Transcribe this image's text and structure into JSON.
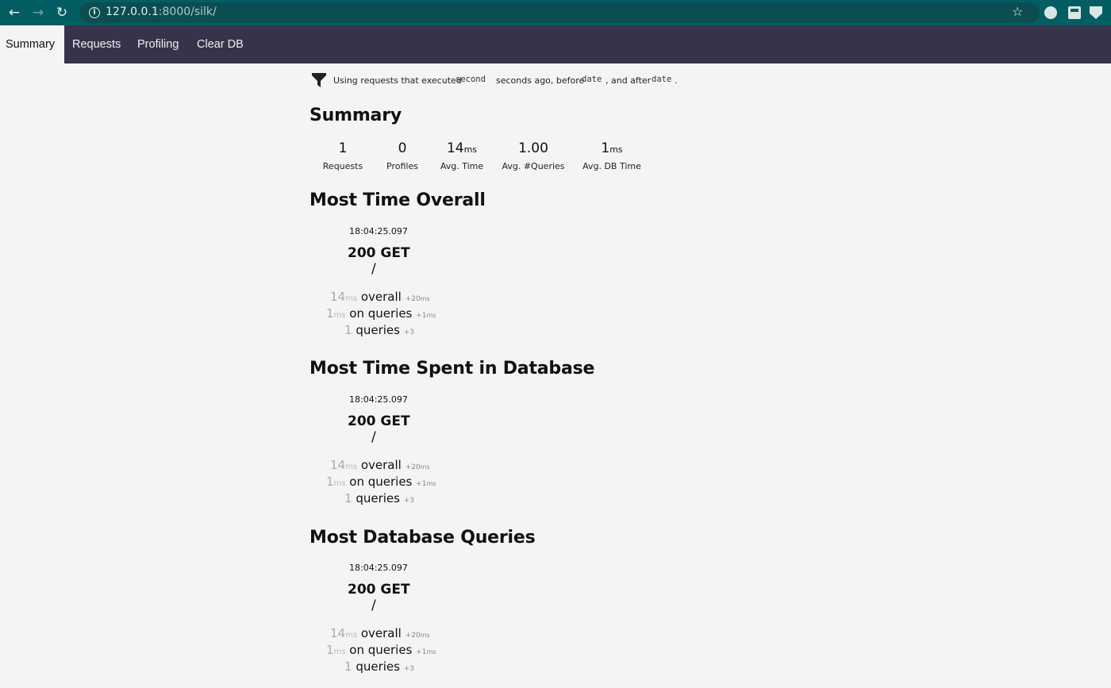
{
  "browser": {
    "url_host": "127.0.0.1",
    "url_rest": ":8000/silk/"
  },
  "nav": {
    "tabs": [
      {
        "label": "Summary"
      },
      {
        "label": "Requests"
      },
      {
        "label": "Profiling"
      },
      {
        "label": "Clear DB"
      }
    ]
  },
  "filter": {
    "prefix": "Using requests that executed",
    "code1": "second",
    "middle": "seconds ago, before",
    "code2": "date",
    "middle2": ", and after",
    "code3": "date",
    "suffix": "."
  },
  "summary": {
    "title": "Summary",
    "stats": [
      {
        "value": "1",
        "unit": "",
        "label": "Requests"
      },
      {
        "value": "0",
        "unit": "",
        "label": "Profiles"
      },
      {
        "value": "14",
        "unit": "ms",
        "label": "Avg. Time"
      },
      {
        "value": "1.00",
        "unit": "",
        "label": "Avg. #Queries"
      },
      {
        "value": "1",
        "unit": "ms",
        "label": "Avg. DB Time"
      }
    ]
  },
  "sections": [
    {
      "title": "Most Time Overall",
      "request": {
        "time": "18:04:25.097",
        "method": "200 GET",
        "path": "/",
        "overall_value": "14",
        "overall_unit": "ms",
        "overall_label": "overall",
        "overall_delta": "+20",
        "overall_delta_unit": "ms",
        "queries_time_value": "1",
        "queries_time_unit": "ms",
        "queries_time_label": "on queries",
        "queries_time_delta": "+1",
        "queries_time_delta_unit": "ms",
        "queries_value": "1",
        "queries_label": "queries",
        "queries_delta": "+3"
      }
    },
    {
      "title": "Most Time Spent in Database",
      "request": {
        "time": "18:04:25.097",
        "method": "200 GET",
        "path": "/",
        "overall_value": "14",
        "overall_unit": "ms",
        "overall_label": "overall",
        "overall_delta": "+20",
        "overall_delta_unit": "ms",
        "queries_time_value": "1",
        "queries_time_unit": "ms",
        "queries_time_label": "on queries",
        "queries_time_delta": "+1",
        "queries_time_delta_unit": "ms",
        "queries_value": "1",
        "queries_label": "queries",
        "queries_delta": "+3"
      }
    },
    {
      "title": "Most Database Queries",
      "request": {
        "time": "18:04:25.097",
        "method": "200 GET",
        "path": "/",
        "overall_value": "14",
        "overall_unit": "ms",
        "overall_label": "overall",
        "overall_delta": "+20",
        "overall_delta_unit": "ms",
        "queries_time_value": "1",
        "queries_time_unit": "ms",
        "queries_time_label": "on queries",
        "queries_time_delta": "+1",
        "queries_time_delta_unit": "ms",
        "queries_value": "1",
        "queries_label": "queries",
        "queries_delta": "+3"
      }
    }
  ]
}
